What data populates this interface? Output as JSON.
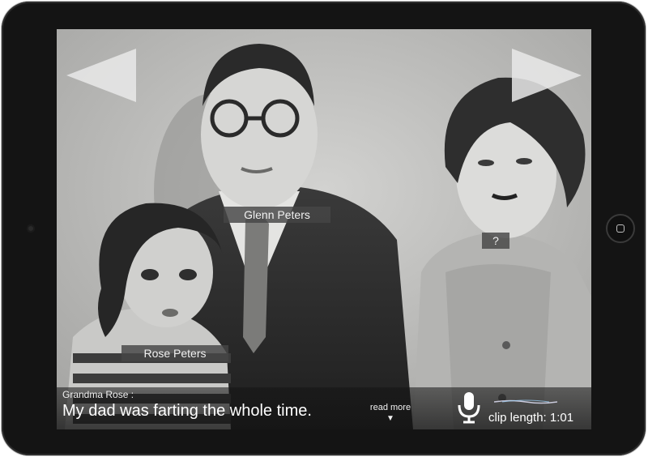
{
  "caption": {
    "speaker": "Grandma Rose :",
    "quote": "My dad was farting the whole time.",
    "read_more": "read more",
    "read_more_arrow": "▼",
    "clip_length": "clip length: 1:01"
  },
  "people_tags": {
    "glenn": "Glenn Peters",
    "unknown": "?",
    "rose": "Rose Peters"
  },
  "icons": {
    "prev": "prev-arrow-icon",
    "next": "next-arrow-icon",
    "mic": "microphone-icon",
    "home": "home-button-icon"
  },
  "colors": {
    "bezel": "#141414",
    "tag_bg": "#464646",
    "text": "#ffffff"
  }
}
